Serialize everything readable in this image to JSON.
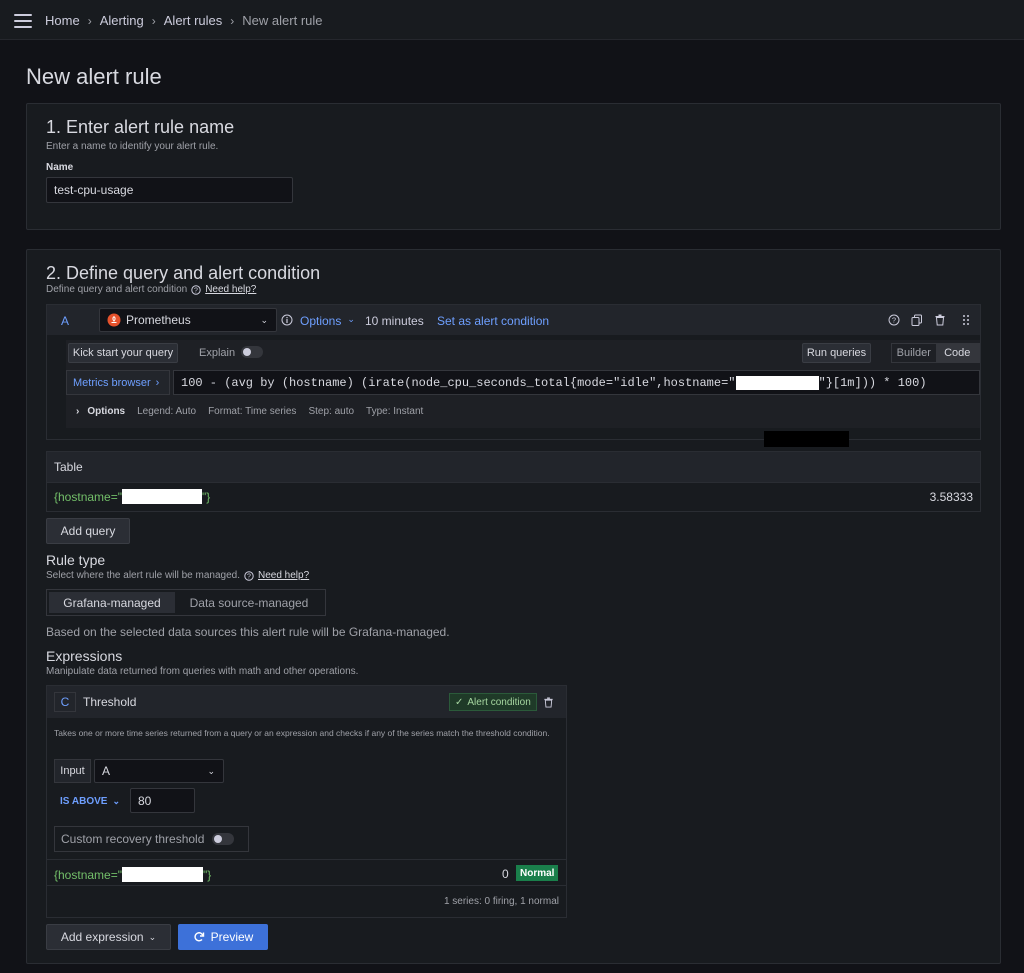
{
  "breadcrumbs": [
    "Home",
    "Alerting",
    "Alert rules",
    "New alert rule"
  ],
  "page_title": "New alert rule",
  "section1": {
    "title": "1. Enter alert rule name",
    "description": "Enter a name to identify your alert rule.",
    "name_label": "Name",
    "name_value": "test-cpu-usage"
  },
  "section2": {
    "title": "2. Define query and alert condition",
    "description": "Define query and alert condition",
    "help_link": "Need help?",
    "query": {
      "ref_id": "A",
      "datasource": "Prometheus",
      "options_label": "Options",
      "time_range": "10 minutes",
      "set_condition": "Set as alert condition",
      "kickstart": "Kick start your query",
      "explain": "Explain",
      "run_queries": "Run queries",
      "builder": "Builder",
      "code": "Code",
      "metrics_browser": "Metrics browser",
      "expr_part1": "100 - (avg by (hostname) (irate(node_cpu_seconds_total{mode=\"idle\",hostname=\"",
      "expr_part2": "\"}[1m])) * 100)",
      "options_row": {
        "label": "Options",
        "legend": "Legend: Auto",
        "format": "Format: Time series",
        "step": "Step: auto",
        "type": "Type: Instant"
      }
    },
    "table": {
      "title": "Table",
      "row_label_prefix": "{hostname=\"",
      "row_label_suffix": "\"}",
      "row_value": "3.58333"
    },
    "add_query": "Add query",
    "rule_type": {
      "title": "Rule type",
      "description": "Select where the alert rule will be managed.",
      "help_link": "Need help?",
      "options": [
        "Grafana-managed",
        "Data source-managed"
      ],
      "selected": "Grafana-managed",
      "note": "Based on the selected data sources this alert rule will be Grafana-managed."
    },
    "expressions": {
      "title": "Expressions",
      "description": "Manipulate data returned from queries with math and other operations.",
      "card": {
        "ref_id": "C",
        "name": "Threshold",
        "badge": "Alert condition",
        "text": "Takes one or more time series returned from a query or an expression and checks if any of the series match the threshold condition.",
        "input_label": "Input",
        "input_value": "A",
        "operator": "IS ABOVE",
        "threshold": "80",
        "recovery": "Custom recovery threshold",
        "result_prefix": "{hostname=\"",
        "result_suffix": "\"}",
        "result_value": "0",
        "result_state": "Normal",
        "summary": "1 series: 0 firing, 1 normal"
      }
    },
    "add_expression": "Add expression",
    "preview": "Preview"
  },
  "colors": {
    "background": "#111217",
    "panel": "#181b1f",
    "link": "#6e9fff",
    "primary": "#3d71d9",
    "success": "#1a7f4b",
    "label_green": "#73bf69"
  },
  "icons": [
    "menu-icon",
    "chevron-right-icon",
    "prometheus-logo-icon",
    "chevron-down-icon",
    "info-icon",
    "help-icon",
    "duplicate-icon",
    "trash-icon",
    "drag-icon",
    "check-icon",
    "refresh-icon"
  ]
}
